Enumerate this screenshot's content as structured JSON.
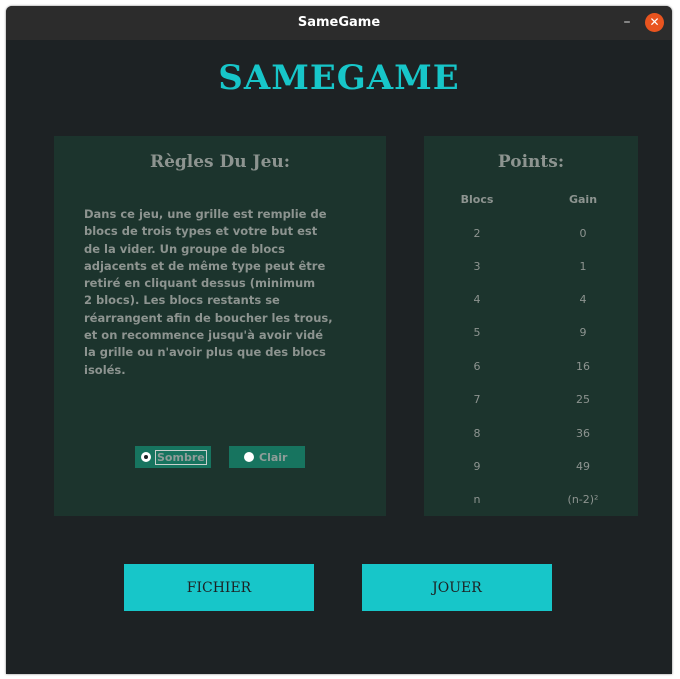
{
  "window": {
    "title": "SameGame",
    "minimize_glyph": "–",
    "close_glyph": "✕"
  },
  "app_title": "SAMEGAME",
  "rules": {
    "title": "Règles Du Jeu:",
    "text": "      Dans ce jeu, une grille est remplie de\nblocs de trois types et votre but est\nde la vider. Un groupe de blocs\nadjacents et de même type peut être\nretiré en cliquant dessus (minimum\n2 blocs). Les blocs restants se\nréarrangent afin de boucher les trous,\net on recommence jusqu'à avoir vidé\nla grille ou n'avoir plus que des blocs\nisolés.",
    "theme_options": [
      {
        "label": "Sombre",
        "selected": true
      },
      {
        "label": "Clair",
        "selected": false
      }
    ]
  },
  "points": {
    "title": "Points:",
    "headers": [
      "Blocs",
      "Gain"
    ],
    "rows": [
      [
        "2",
        "0"
      ],
      [
        "3",
        "1"
      ],
      [
        "4",
        "4"
      ],
      [
        "5",
        "9"
      ],
      [
        "6",
        "16"
      ],
      [
        "7",
        "25"
      ],
      [
        "8",
        "36"
      ],
      [
        "9",
        "49"
      ],
      [
        "n",
        "(n-2)²"
      ]
    ]
  },
  "buttons": {
    "fichier": "FICHIER",
    "jouer": "JOUER"
  },
  "colors": {
    "accent": "#17c6c9",
    "background": "#1d2224",
    "panel": "#1c342d",
    "text_muted": "#8d9490",
    "radio_bg": "#17745f",
    "close_button": "#e9541f"
  }
}
